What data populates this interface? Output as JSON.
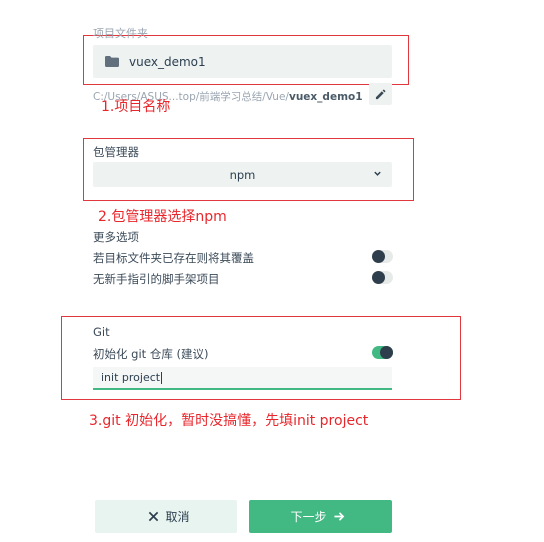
{
  "project": {
    "section_label": "项目文件夹",
    "folder_name": "vuex_demo1",
    "path_prefix": "C:/Users/ASUS...top/前端学习总结/Vue/",
    "path_bold": "vuex_demo1"
  },
  "package_manager": {
    "label": "包管理器",
    "selected": "npm"
  },
  "more_options": {
    "label": "更多选项",
    "items": [
      {
        "label": "若目标文件夹已存在则将其覆盖",
        "enabled": false
      },
      {
        "label": "无新手指引的脚手架项目",
        "enabled": false
      }
    ]
  },
  "git": {
    "label": "Git",
    "init_label": "初始化 git 仓库 (建议)",
    "init_enabled": true,
    "commit_message": "init project"
  },
  "buttons": {
    "cancel": "取消",
    "next": "下一步"
  },
  "annotations": {
    "a1": "1.项目名称",
    "a2": "2.包管理器选择npm",
    "a3": "3.git 初始化，暂时没搞懂，先填init project"
  },
  "colors": {
    "accent": "#42b983",
    "annotation": "#e8262b",
    "field_bg": "#eef3f1"
  }
}
